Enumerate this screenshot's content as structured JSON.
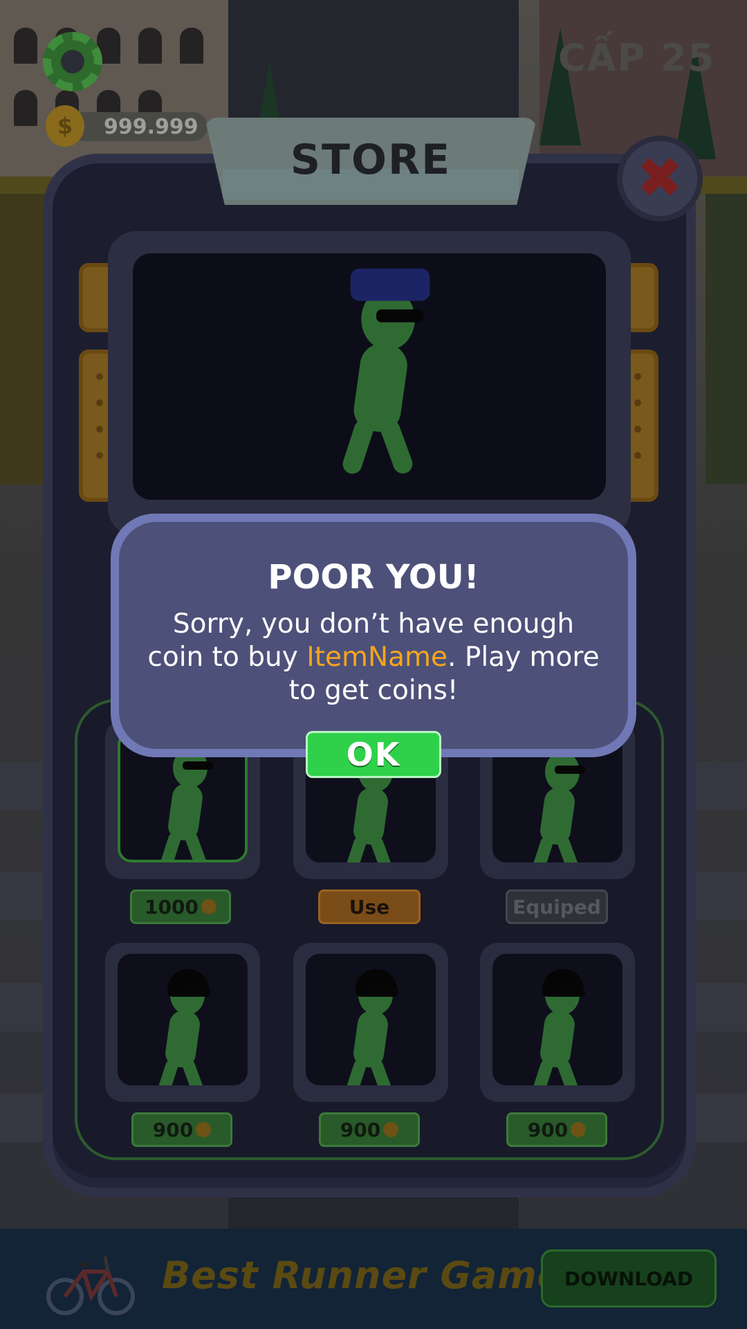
{
  "hud": {
    "coins": "999.999",
    "coin_symbol": "$",
    "level": "CẤP 25"
  },
  "store": {
    "title": "STORE",
    "close_symbol": "✖",
    "items": [
      {
        "price_label": "1000",
        "state": "price",
        "accessory": "cap",
        "selected": true
      },
      {
        "price_label": "Use",
        "state": "use",
        "accessory": "glasses"
      },
      {
        "price_label": "Equiped",
        "state": "equipped",
        "accessory": "glasses"
      },
      {
        "price_label": "900",
        "state": "price",
        "accessory": "hair"
      },
      {
        "price_label": "900",
        "state": "price",
        "accessory": "hair"
      },
      {
        "price_label": "900",
        "state": "price",
        "accessory": "hair"
      }
    ]
  },
  "modal": {
    "title": "POOR YOU!",
    "message_before": "Sorry, you don’t have enough coin to buy ",
    "item_name": "ItemName",
    "message_after": ". Play more to get coins!",
    "ok_label": "OK"
  },
  "ad": {
    "headline": "Best Runner Game",
    "cta": "DOWNLOAD"
  },
  "colors": {
    "ok_green": "#2fd14a",
    "highlight": "#f6a51e",
    "modal_bg": "#4d5179",
    "modal_border": "#7079b6"
  },
  "icons": [
    "gear-icon",
    "coin-icon",
    "close-icon",
    "bicycle-icon"
  ]
}
